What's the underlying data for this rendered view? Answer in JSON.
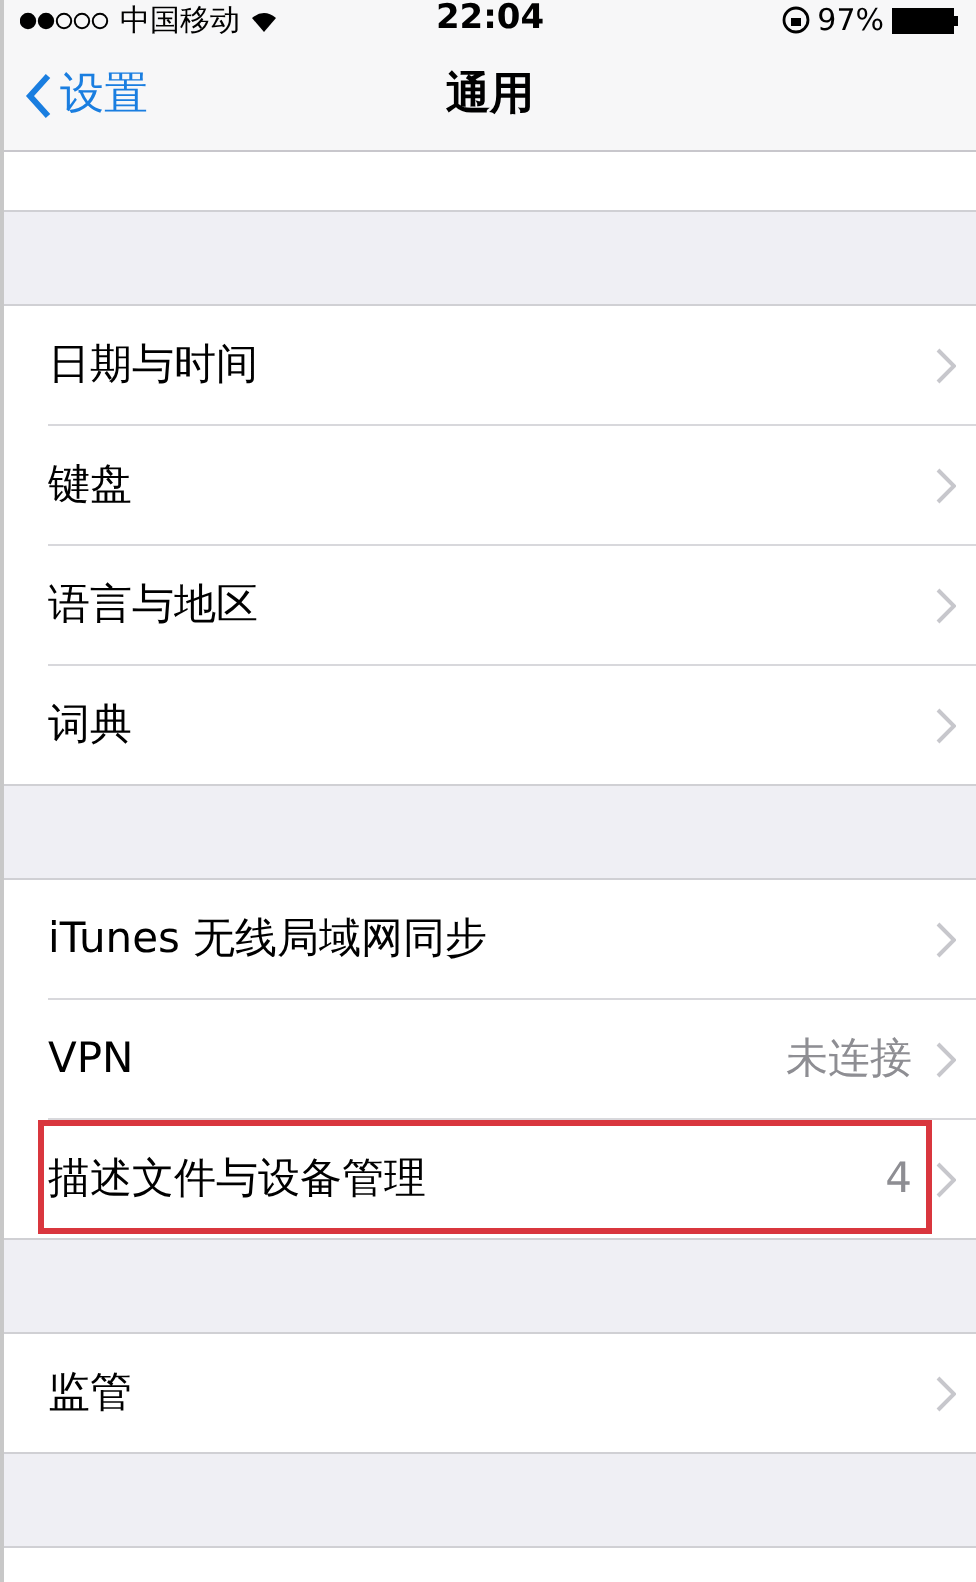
{
  "status_bar": {
    "carrier": "中国移动",
    "time": "22:04",
    "battery": "97%"
  },
  "nav": {
    "back": "设置",
    "title": "通用"
  },
  "groups": [
    {
      "rows": [
        {
          "label": "日期与时间",
          "highlighted": false
        },
        {
          "label": "键盘",
          "highlighted": false
        },
        {
          "label": "语言与地区",
          "highlighted": false
        },
        {
          "label": "词典",
          "highlighted": false
        }
      ]
    },
    {
      "rows": [
        {
          "label": "iTunes 无线局域网同步",
          "highlighted": false
        },
        {
          "label": "VPN",
          "value": "未连接",
          "highlighted": false
        },
        {
          "label": "描述文件与设备管理",
          "value": "4",
          "highlighted": true
        }
      ]
    },
    {
      "rows": [
        {
          "label": "监管",
          "highlighted": false
        }
      ]
    }
  ]
}
